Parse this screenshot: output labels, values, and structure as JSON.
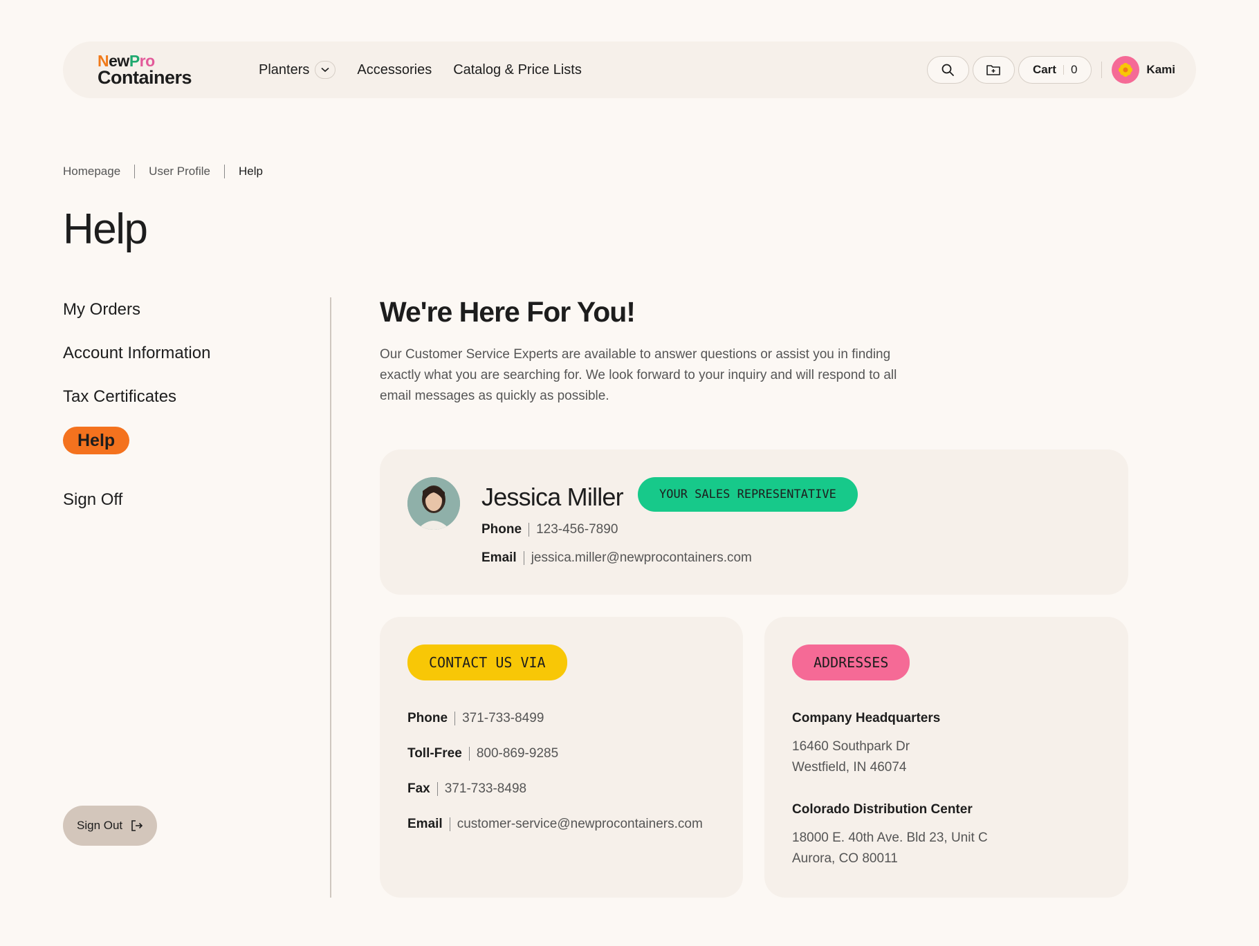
{
  "header": {
    "logo_top_1": "New",
    "logo_top_2": "Pro",
    "logo_bottom": "Containers",
    "nav": [
      {
        "label": "Planters"
      },
      {
        "label": "Accessories"
      },
      {
        "label": "Catalog & Price Lists"
      }
    ],
    "cart_label": "Cart",
    "cart_count": "0",
    "user_name": "Kami"
  },
  "breadcrumb": [
    "Homepage",
    "User Profile",
    "Help"
  ],
  "page_title": "Help",
  "sidebar": {
    "items": [
      "My Orders",
      "Account Information",
      "Tax Certificates",
      "Help",
      "Sign Off"
    ],
    "sign_out": "Sign Out"
  },
  "main": {
    "title": "We're Here For You!",
    "description": "Our Customer Service Experts are available to answer questions or assist you in finding exactly what you are searching for. We look forward to your inquiry and will respond to all email messages as quickly as possible."
  },
  "rep": {
    "name": "Jessica Miller",
    "badge": "YOUR SALES REPRESENTATIVE",
    "phone_label": "Phone",
    "phone": "123-456-7890",
    "email_label": "Email",
    "email": "jessica.miller@newprocontainers.com"
  },
  "contact": {
    "badge": "CONTACT US VIA",
    "rows": [
      {
        "label": "Phone",
        "value": "371-733-8499"
      },
      {
        "label": "Toll-Free",
        "value": "800-869-9285"
      },
      {
        "label": "Fax",
        "value": "371-733-8498"
      },
      {
        "label": "Email",
        "value": "customer-service@newprocontainers.com"
      }
    ]
  },
  "addresses": {
    "badge": "ADDRESSES",
    "hq_title": "Company Headquarters",
    "hq_line1": "16460 Southpark Dr",
    "hq_line2": "Westfield, IN 46074",
    "co_title": "Colorado Distribution Center",
    "co_line1": "18000 E. 40th Ave. Bld 23, Unit C",
    "co_line2": "Aurora, CO 80011"
  },
  "colors": {
    "accent_orange": "#f4721e",
    "green": "#17c98a",
    "yellow": "#f8c706",
    "pink": "#f56a96"
  }
}
